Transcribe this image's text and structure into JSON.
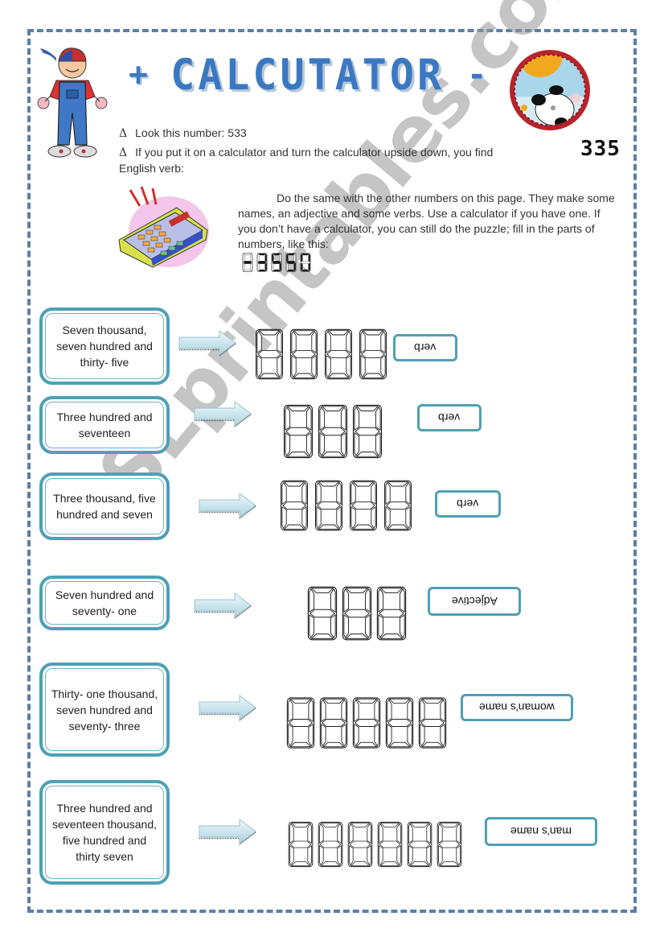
{
  "header": {
    "title": "CALCUTATOR",
    "plus_sign": "+",
    "minus_sign": "-"
  },
  "intro": {
    "bullet_symbol": "Δ",
    "line1": "Look this number: 533",
    "line2": "If you put it on a calculator  and turn the calculator upside down, you find",
    "line3": "English verb:",
    "upside_down_number": "335"
  },
  "instructions": {
    "text": "Do the same with the other numbers on this page. They make some names, an adjective and some verbs. Use a calculator if you have one. If you don’t have a calculator, you can still do the puzzle; fill in the parts  of numbers, like this:",
    "example_digits": 5
  },
  "exercises": [
    {
      "number_words": "Seven thousand, seven hundred and thirty- five",
      "digit_count": 4,
      "label": "verb"
    },
    {
      "number_words": "Three hundred and seventeen",
      "digit_count": 3,
      "label": "verb"
    },
    {
      "number_words": "Three thousand, five hundred and seven",
      "digit_count": 4,
      "label": "verb"
    },
    {
      "number_words": "Seven hundred and seventy- one",
      "digit_count": 3,
      "label": "Adjective"
    },
    {
      "number_words": "Thirty- one thousand, seven hundred and seventy- three",
      "digit_count": 5,
      "label": "woman’s name"
    },
    {
      "number_words": "Three hundred and seventeen thousand, five hundred and thirty seven",
      "digit_count": 6,
      "label": "man’s name"
    }
  ],
  "watermark": "ESLprintables.com",
  "colors": {
    "title_blue": "#3b78c2",
    "border_blue": "#5a7fa8",
    "box_teal": "#4fa0b5"
  }
}
